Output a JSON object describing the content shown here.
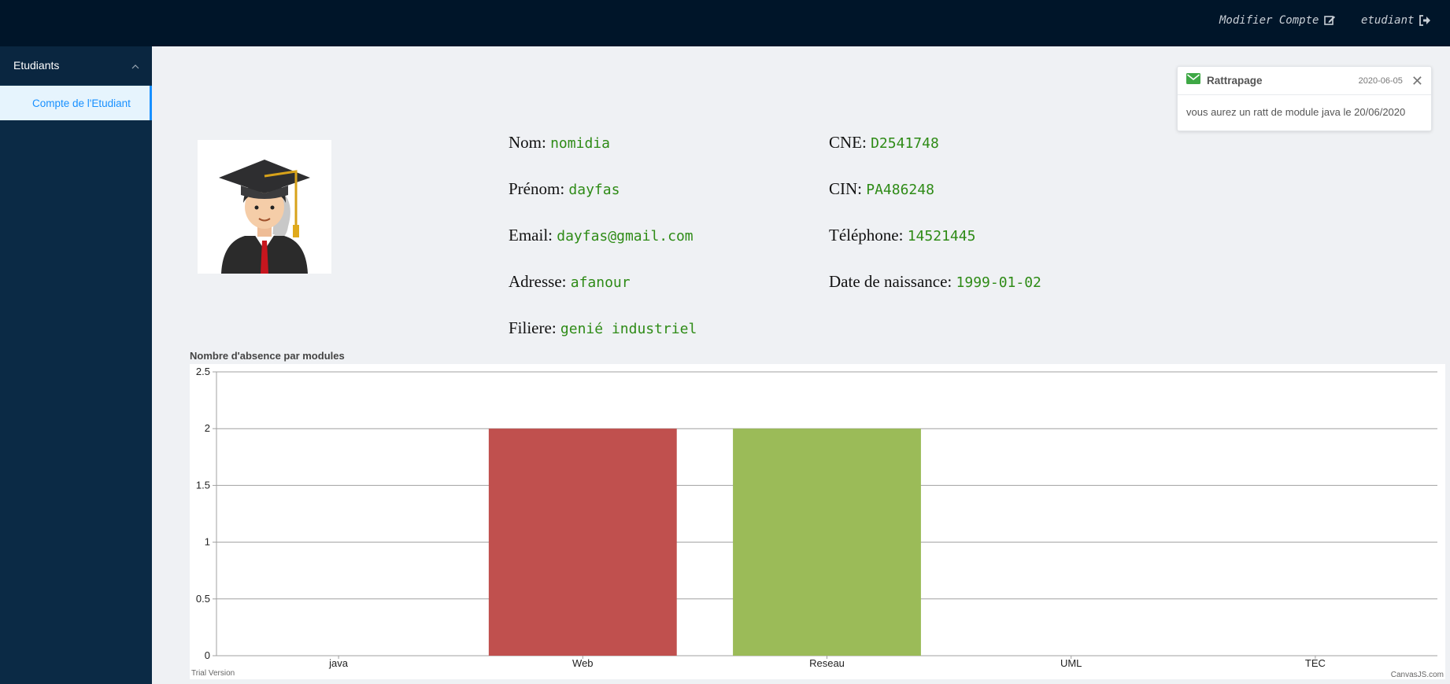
{
  "topbar": {
    "modify_account": "Modifier Compte",
    "user": "etudiant",
    "modify_icon": "edit-icon",
    "logout_icon": "sign-out-icon"
  },
  "sidebar": {
    "section": "Etudiants",
    "items": [
      {
        "label": "Compte de l'Etudiant",
        "active": true
      }
    ]
  },
  "student": {
    "nom_label": "Nom:",
    "nom": "nomidia",
    "prenom_label": "Prénom:",
    "prenom": "dayfas",
    "email_label": "Email:",
    "email": "dayfas@gmail.com",
    "adresse_label": "Adresse:",
    "adresse": "afanour",
    "filiere_label": "Filiere:",
    "filiere": "genié industriel",
    "cne_label": "CNE:",
    "cne": "D2541748",
    "cin_label": "CIN:",
    "cin": "PA486248",
    "tel_label": "Téléphone:",
    "tel": "14521445",
    "naissance_label": "Date de naissance:",
    "naissance": "1999-01-02"
  },
  "notification": {
    "title": "Rattrapage",
    "date": "2020-06-05",
    "message": "vous aurez un ratt de module java le 20/06/2020",
    "icon": "envelope-icon"
  },
  "chart_data": {
    "type": "bar",
    "title": "Nombre d'absence par modules",
    "categories": [
      "java",
      "Web",
      "Reseau",
      "UML",
      "TEC"
    ],
    "values": [
      0,
      2,
      2,
      0,
      0
    ],
    "colors": [
      "#4f81bc",
      "#c0504e",
      "#9bbb58",
      "#23bfaa",
      "#8064a1"
    ],
    "ylim": [
      0,
      2.5
    ],
    "yticks": [
      "0",
      "0.5",
      "1",
      "1.5",
      "2",
      "2.5"
    ],
    "grid": true,
    "trial_text": "Trial Version",
    "credit": "CanvasJS.com"
  }
}
